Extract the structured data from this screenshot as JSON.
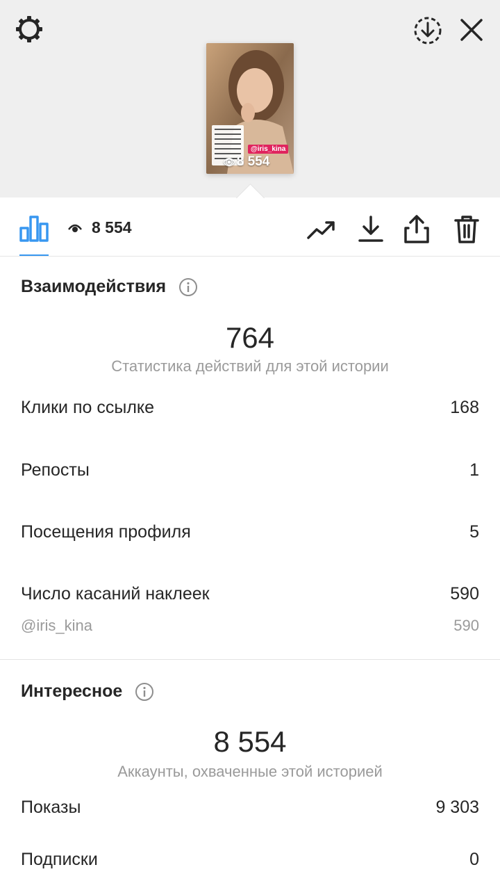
{
  "header": {
    "icons": [
      "settings-gear-icon",
      "download-circle-icon",
      "close-icon"
    ]
  },
  "preview": {
    "tag": "@iris_kina",
    "views": "8 554"
  },
  "toolbar": {
    "views_count": "8 554",
    "icons": [
      "bar-chart-icon",
      "eye-icon",
      "trend-icon",
      "download-icon",
      "share-icon",
      "trash-icon"
    ],
    "accent": "#3897f0"
  },
  "interactions": {
    "title": "Взаимодействия",
    "total": "764",
    "caption": "Статистика действий для этой истории",
    "rows": [
      {
        "label": "Клики по ссылке",
        "value": "168"
      },
      {
        "label": "Репосты",
        "value": "1"
      },
      {
        "label": "Посещения профиля",
        "value": "5"
      },
      {
        "label": "Число касаний наклеек",
        "value": "590"
      }
    ],
    "sticker": {
      "label": "@iris_kina",
      "value": "590"
    }
  },
  "discovery": {
    "title": "Интересное",
    "total": "8 554",
    "caption": "Аккаунты, охваченные этой историей",
    "rows": [
      {
        "label": "Показы",
        "value": "9 303"
      },
      {
        "label": "Подписки",
        "value": "0"
      }
    ]
  }
}
